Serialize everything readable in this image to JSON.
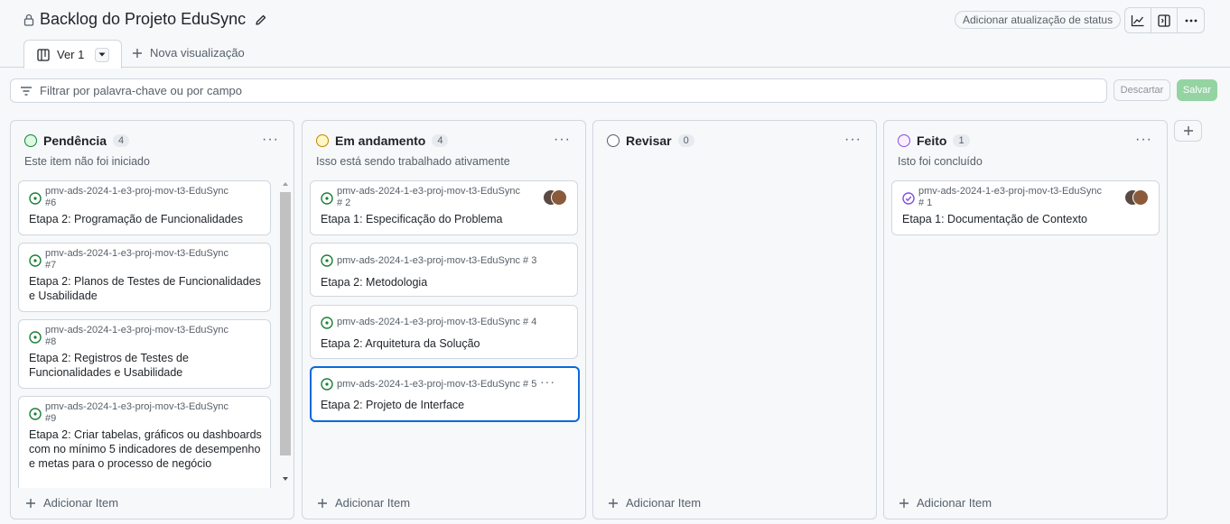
{
  "header": {
    "title": "Backlog do Projeto EduSync",
    "status_button": "Adicionar atualização de status"
  },
  "tabs": {
    "active_label": "Ver 1",
    "new_view_label": "Nova visualização"
  },
  "filter": {
    "placeholder": "Filtrar por palavra-chave ou por campo",
    "discard_label": "Descartar",
    "save_label": "Salvar"
  },
  "colors": {
    "todo": "#1a7f37",
    "in_progress": "#bf8700",
    "review": "#57606a",
    "done": "#8250df",
    "focus": "#0969da"
  },
  "columns": [
    {
      "name": "Pendência",
      "count": "4",
      "description": "Este item não foi iniciado",
      "add_label": "Adicionar Item",
      "cards": [
        {
          "ref1": "pmv-ads-2024-1-e3-proj-mov-t3-EduSync",
          "ref2": "#6",
          "title": "Etapa 2: Programação de Funcionalidades"
        },
        {
          "ref1": "pmv-ads-2024-1-e3-proj-mov-t3-EduSync",
          "ref2": "#7",
          "title": "Etapa 2: Planos de Testes de Funcionalidades e Usabilidade"
        },
        {
          "ref1": "pmv-ads-2024-1-e3-proj-mov-t3-EduSync",
          "ref2": "#8",
          "title": "Etapa 2: Registros de Testes de Funcionalidades e Usabilidade"
        },
        {
          "ref1": "pmv-ads-2024-1-e3-proj-mov-t3-EduSync",
          "ref2": "#9",
          "title": "Etapa 2: Criar tabelas, gráficos ou dashboards com no mínimo 5 indicadores de desempenho e metas para o processo de negócio"
        }
      ]
    },
    {
      "name": "Em andamento",
      "count": "4",
      "description": "Isso está sendo trabalhado ativamente",
      "add_label": "Adicionar Item",
      "cards": [
        {
          "ref1": "pmv-ads-2024-1-e3-proj-mov-t3-EduSync",
          "ref2": "# 2",
          "title": "Etapa 1: Especificação do Problema"
        },
        {
          "ref1": "pmv-ads-2024-1-e3-proj-mov-t3-EduSync # 3",
          "ref2": "",
          "title": "Etapa 2: Metodologia"
        },
        {
          "ref1": "pmv-ads-2024-1-e3-proj-mov-t3-EduSync # 4",
          "ref2": "",
          "title": "Etapa 2: Arquitetura da Solução"
        },
        {
          "ref1": "pmv-ads-2024-1-e3-proj-mov-t3-EduSync # 5",
          "ref2": "",
          "title": "Etapa 2: Projeto de Interface"
        }
      ]
    },
    {
      "name": "Revisar",
      "count": "0",
      "description": "",
      "add_label": "Adicionar Item",
      "cards": []
    },
    {
      "name": "Feito",
      "count": "1",
      "description": "Isto foi concluído",
      "add_label": "Adicionar Item",
      "cards": [
        {
          "ref1": "pmv-ads-2024-1-e3-proj-mov-t3-EduSync",
          "ref2": "# 1",
          "title": "Etapa 1: Documentação de Contexto"
        }
      ]
    }
  ]
}
